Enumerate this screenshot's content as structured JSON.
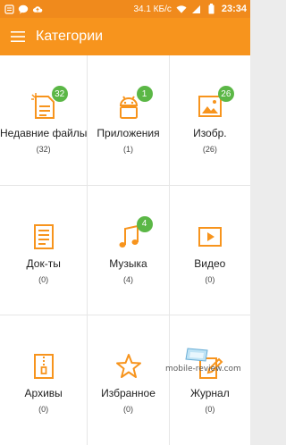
{
  "statusbar": {
    "speed": "34.1 КБ/с",
    "time": "23:34"
  },
  "appbar": {
    "title": "Категории"
  },
  "categories": [
    {
      "label": "Недавние файлы",
      "count": "(32)",
      "badge": "32",
      "icon": "recent-files-icon"
    },
    {
      "label": "Приложения",
      "count": "(1)",
      "badge": "1",
      "icon": "android-icon"
    },
    {
      "label": "Изобр.",
      "count": "(26)",
      "badge": "26",
      "icon": "image-icon"
    },
    {
      "label": "Док-ты",
      "count": "(0)",
      "badge": "",
      "icon": "document-icon"
    },
    {
      "label": "Музыка",
      "count": "(4)",
      "badge": "4",
      "icon": "music-note-icon"
    },
    {
      "label": "Видео",
      "count": "(0)",
      "badge": "",
      "icon": "video-play-icon"
    },
    {
      "label": "Архивы",
      "count": "(0)",
      "badge": "",
      "icon": "archive-zip-icon"
    },
    {
      "label": "Избранное",
      "count": "(0)",
      "badge": "",
      "icon": "star-icon"
    },
    {
      "label": "Журнал",
      "count": "(0)",
      "badge": "",
      "icon": "log-edit-icon"
    }
  ],
  "watermark": "mobile-review.com",
  "colors": {
    "accent": "#f7941d",
    "badge": "#5bb746"
  }
}
